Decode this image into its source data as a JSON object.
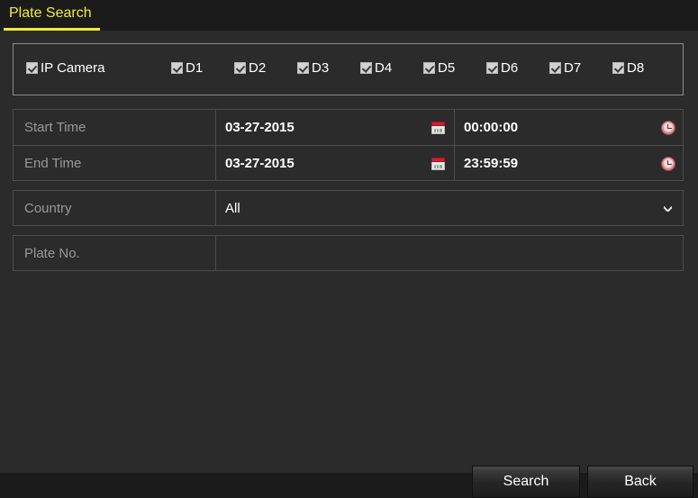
{
  "window": {
    "title": "Plate Search",
    "accent_color": "#f2ec39",
    "background_color": "#2b2b2b"
  },
  "camera_group": {
    "items": [
      {
        "label": "IP Camera",
        "checked": true,
        "icon": "checkbox-checked-icon"
      },
      {
        "label": "D1",
        "checked": true,
        "icon": "checkbox-checked-icon"
      },
      {
        "label": "D2",
        "checked": true,
        "icon": "checkbox-checked-icon"
      },
      {
        "label": "D3",
        "checked": true,
        "icon": "checkbox-checked-icon"
      },
      {
        "label": "D4",
        "checked": true,
        "icon": "checkbox-checked-icon"
      },
      {
        "label": "D5",
        "checked": true,
        "icon": "checkbox-checked-icon"
      },
      {
        "label": "D6",
        "checked": true,
        "icon": "checkbox-checked-icon"
      },
      {
        "label": "D7",
        "checked": true,
        "icon": "checkbox-checked-icon"
      },
      {
        "label": "D8",
        "checked": true,
        "icon": "checkbox-checked-icon"
      }
    ]
  },
  "form": {
    "start_time": {
      "label": "Start Time",
      "date": "03-27-2015",
      "time": "00:00:00",
      "date_icon": "calendar-icon",
      "time_icon": "clock-icon"
    },
    "end_time": {
      "label": "End Time",
      "date": "03-27-2015",
      "time": "23:59:59",
      "date_icon": "calendar-icon",
      "time_icon": "clock-icon"
    },
    "country": {
      "label": "Country",
      "value": "All",
      "icon": "chevron-down-icon"
    },
    "plate_no": {
      "label": "Plate No.",
      "value": "",
      "placeholder": ""
    }
  },
  "buttons": {
    "search": "Search",
    "back": "Back"
  }
}
